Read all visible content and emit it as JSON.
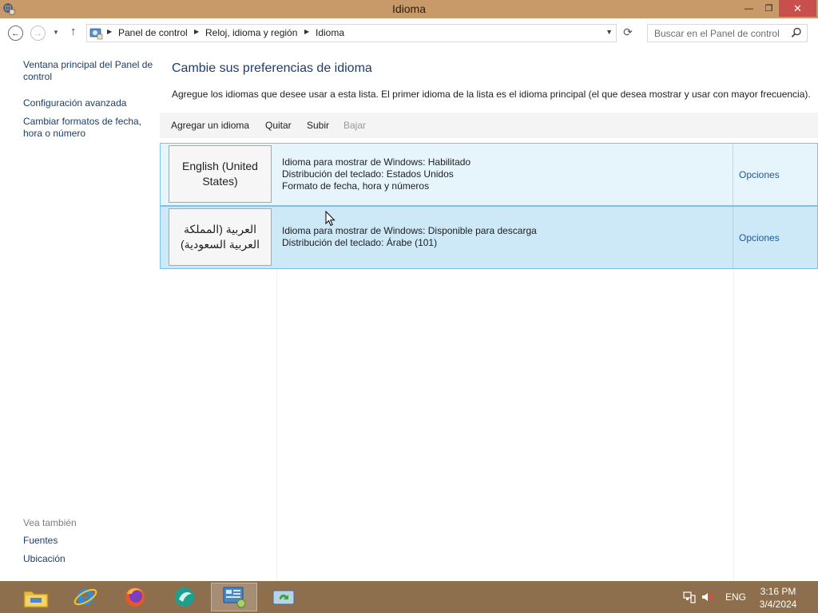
{
  "window": {
    "title": "Idioma"
  },
  "titlebar": {
    "minimize": "—",
    "maximize": "❐",
    "close": "✕"
  },
  "nav": {
    "breadcrumbs": [
      "Panel de control",
      "Reloj, idioma y región",
      "Idioma"
    ],
    "search_placeholder": "Buscar en el Panel de control"
  },
  "sidebar": {
    "links": [
      "Ventana principal del Panel de control",
      "Configuración avanzada",
      "Cambiar formatos de fecha, hora o número"
    ],
    "see_also_title": "Vea también",
    "see_also": [
      "Fuentes",
      "Ubicación"
    ]
  },
  "main": {
    "title": "Cambie sus preferencias de idioma",
    "description": "Agregue los idiomas que desee usar a esta lista. El primer idioma de la lista es el idioma principal (el que desea mostrar y usar con mayor frecuencia).",
    "commands": [
      "Agregar un idioma",
      "Quitar",
      "Subir",
      "Bajar"
    ],
    "languages": [
      {
        "name": "English (United States)",
        "lines": [
          "Idioma para mostrar de Windows: Habilitado",
          "Distribución del teclado: Estados Unidos",
          "Formato de fecha, hora y números"
        ],
        "options": "Opciones"
      },
      {
        "name": "العربية (المملكة العربية السعودية)",
        "lines": [
          "Idioma para mostrar de Windows: Disponible para descarga",
          "Distribución del teclado: Árabe (101)"
        ],
        "options": "Opciones"
      }
    ]
  },
  "taskbar": {
    "apps": [
      "file-explorer",
      "internet-explorer",
      "firefox",
      "app-teal",
      "control-panel",
      "sync-app"
    ],
    "active_app": "control-panel",
    "tray": {
      "language": "ENG",
      "time": "3:16 PM",
      "date": "3/4/2024"
    }
  }
}
